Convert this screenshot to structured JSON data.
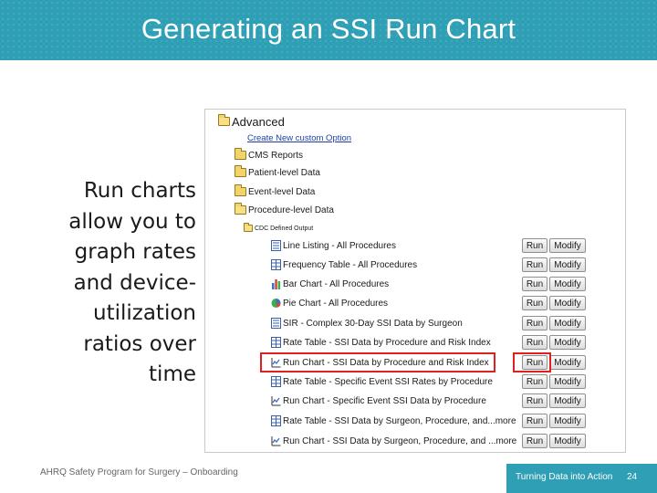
{
  "header": {
    "title": "Generating an SSI Run Chart"
  },
  "side_text": [
    "Run charts",
    "allow you to",
    "graph rates",
    "and device-",
    "utilization",
    "ratios over",
    "time"
  ],
  "tree": {
    "root": "Advanced",
    "create_link": "Create New custom Option",
    "folders": [
      "CMS Reports",
      "Patient-level Data",
      "Event-level Data",
      "Procedure-level Data"
    ],
    "subfolder": "CDC Defined Output"
  },
  "reports": [
    {
      "label": "Line Listing - All Procedures",
      "icon": "line-listing-icon"
    },
    {
      "label": "Frequency Table - All Procedures",
      "icon": "frequency-table-icon"
    },
    {
      "label": "Bar Chart - All Procedures",
      "icon": "bar-chart-icon"
    },
    {
      "label": "Pie Chart - All Procedures",
      "icon": "pie-chart-icon"
    },
    {
      "label": "SIR - Complex 30-Day SSI Data by Surgeon",
      "icon": "sir-report-icon"
    },
    {
      "label": "Rate Table - SSI Data by Procedure and Risk Index",
      "icon": "rate-table-icon"
    },
    {
      "label": "Run Chart - SSI Data by Procedure and Risk Index",
      "icon": "run-chart-icon"
    },
    {
      "label": "Rate Table - Specific Event SSI Rates by Procedure",
      "icon": "rate-table-icon"
    },
    {
      "label": "Run Chart - Specific Event SSI Data by Procedure",
      "icon": "run-chart-icon"
    },
    {
      "label": "Rate Table - SSI Data by Surgeon, Procedure, and...more",
      "icon": "rate-table-icon"
    },
    {
      "label": "Run Chart - SSI Data by Surgeon, Procedure, and ...more",
      "icon": "run-chart-icon"
    }
  ],
  "buttons": {
    "run": "Run",
    "modify": "Modify"
  },
  "footer": {
    "left": "AHRQ Safety Program for Surgery – Onboarding",
    "right": "Turning Data into Action",
    "page": "24"
  },
  "colors": {
    "header_bg": "#2e9fb5",
    "highlight": "#e02020",
    "link": "#1f3fa8"
  }
}
